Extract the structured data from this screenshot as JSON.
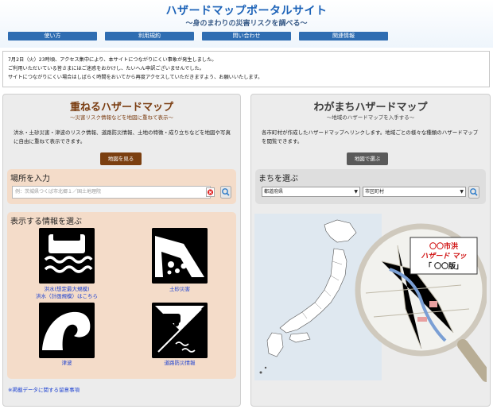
{
  "header": {
    "title": "ハザードマップポータルサイト",
    "subtitle": "～身のまわりの災害リスクを調べる～",
    "nav": [
      "使い方",
      "利用規約",
      "問い合わせ",
      "関連情報"
    ]
  },
  "notice": {
    "lines": [
      "7月2日（火）23時頃、アクセス集中により、本サイトにつながりにくい事象が発生しました。",
      "ご利用いただいている皆さまにはご迷惑をおかけし、たいへん申訳ございませんでした。",
      "サイトにつながりにくい場合はしばらく時間をおいてから再度アクセスしていただきますよう、お願いいたします。"
    ]
  },
  "left_panel": {
    "title": "重ねるハザードマップ",
    "subtitle": "～災害リスク情報などを地図に重ねて表示～",
    "description": "洪水・土砂災害・津波のリスク情報、道路防災情報、土地の特徴・成り立ちなどを地図や写真に自由に重ねて表示できます。",
    "button": "地図を見る",
    "place_label": "場所を入力",
    "place_placeholder": "例：茨城県つくば市北郷１／国土地理院",
    "info_label": "表示する情報を選ぶ",
    "hazards": {
      "flood_label_1": "洪水(想定最大規模)",
      "flood_label_2": "洪水（計画規模）はこちら",
      "landslide_label": "土砂災害",
      "tsunami_label": "津波",
      "road_label": "道路防災情報"
    },
    "footnote": "※掲載データに関する留意事項"
  },
  "right_panel": {
    "title": "わがまちハザードマップ",
    "subtitle": "～地域のハザードマップを入手する～",
    "description": "各市町村が作成したハザードマップへリンクします。地域ごとの様々な種類のハザードマップを閲覧できます。",
    "button": "地図で選ぶ",
    "town_label": "まちを選ぶ",
    "pref_select": "都道府県",
    "city_select": "市区町村",
    "magnifier_line1": "〇〇市洪",
    "magnifier_line2": "ハザード マッ",
    "magnifier_line3": "「 〇〇版」"
  },
  "colors": {
    "brand_blue": "#1d63b8",
    "nav_blue": "#2f6db2",
    "brown": "#7b3f10",
    "peach": "#f4dcc9",
    "link_blue": "#1a3fd1"
  }
}
